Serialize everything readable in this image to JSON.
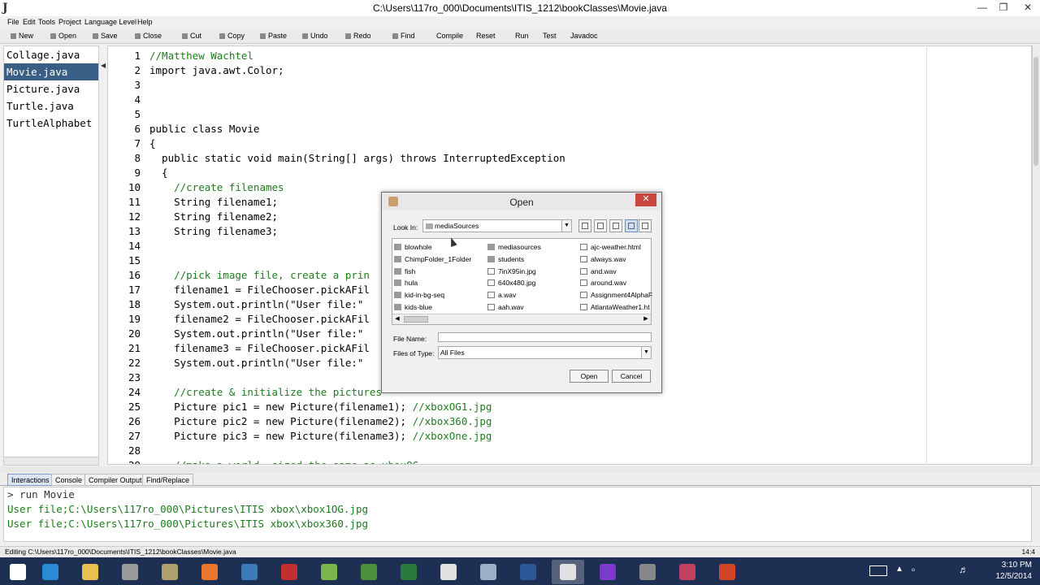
{
  "window": {
    "title": "C:\\Users\\117ro_000\\Documents\\ITIS_1212\\bookClasses\\Movie.java",
    "app_icon": "J"
  },
  "menu": [
    "File",
    "Edit",
    "Tools",
    "Project",
    "Language Level",
    "Help"
  ],
  "toolbar": [
    "New",
    "Open",
    "Save",
    "Close",
    "Cut",
    "Copy",
    "Paste",
    "Undo",
    "Redo",
    "Find",
    "Compile",
    "Reset",
    "Run",
    "Test",
    "Javadoc"
  ],
  "files": [
    "Collage.java",
    "Movie.java",
    "Picture.java",
    "Turtle.java",
    "TurtleAlphabet"
  ],
  "active_file": "Movie.java",
  "code": [
    {
      "n": "1",
      "text": "//Matthew Wachtel",
      "comment": true
    },
    {
      "n": "2",
      "text": "import java.awt.Color;",
      "comment": false
    },
    {
      "n": "3",
      "text": "",
      "comment": false
    },
    {
      "n": "4",
      "text": "",
      "comment": false
    },
    {
      "n": "5",
      "text": "",
      "comment": false
    },
    {
      "n": "6",
      "text": "public class Movie",
      "comment": false
    },
    {
      "n": "7",
      "text": "{",
      "comment": false
    },
    {
      "n": "8",
      "text": "  public static void main(String[] args) throws InterruptedException",
      "comment": false
    },
    {
      "n": "9",
      "text": "  {",
      "comment": false
    },
    {
      "n": "10",
      "text": "    //create filenames",
      "comment": true
    },
    {
      "n": "11",
      "text": "    String filename1;",
      "comment": false
    },
    {
      "n": "12",
      "text": "    String filename2;",
      "comment": false
    },
    {
      "n": "13",
      "text": "    String filename3;",
      "comment": false
    },
    {
      "n": "14",
      "text": "",
      "comment": false
    },
    {
      "n": "15",
      "text": "",
      "comment": false
    },
    {
      "n": "16",
      "text": "    //pick image file, create a prin",
      "comment": true
    },
    {
      "n": "17",
      "text": "    filename1 = FileChooser.pickAFil",
      "comment": false
    },
    {
      "n": "18",
      "text": "    System.out.println(\"User file:\"",
      "comment": false
    },
    {
      "n": "19",
      "text": "    filename2 = FileChooser.pickAFil",
      "comment": false
    },
    {
      "n": "20",
      "text": "    System.out.println(\"User file:\"",
      "comment": false
    },
    {
      "n": "21",
      "text": "    filename3 = FileChooser.pickAFil",
      "comment": false
    },
    {
      "n": "22",
      "text": "    System.out.println(\"User file:\"",
      "comment": false
    },
    {
      "n": "23",
      "text": "",
      "comment": false
    },
    {
      "n": "24",
      "text": "    //create & initialize the pictures",
      "comment": true
    },
    {
      "n": "25",
      "text": "    Picture pic1 = new Picture(filename1); ",
      "tail": "//xboxOG1.jpg",
      "comment": false
    },
    {
      "n": "26",
      "text": "    Picture pic2 = new Picture(filename2); ",
      "tail": "//xbox360.jpg",
      "comment": false
    },
    {
      "n": "27",
      "text": "    Picture pic3 = new Picture(filename3); ",
      "tail": "//xboxOne.jpg",
      "comment": false
    },
    {
      "n": "28",
      "text": "",
      "comment": false
    },
    {
      "n": "29",
      "text": "    //make a world, sized the same as xboxOG",
      "comment": true
    }
  ],
  "bottom_tabs": [
    "Interactions",
    "Console",
    "Compiler Output",
    "Find/Replace"
  ],
  "active_tab": "Interactions",
  "console": [
    {
      "text": "> run Movie",
      "kind": "cmd"
    },
    {
      "text": "User file;C:\\Users\\117ro_000\\Pictures\\ITIS xbox\\xbox1OG.jpg",
      "kind": "out"
    },
    {
      "text": "User file;C:\\Users\\117ro_000\\Pictures\\ITIS xbox\\xbox360.jpg",
      "kind": "out"
    }
  ],
  "status": {
    "text": "Editing C:\\Users\\117ro_000\\Documents\\ITIS_1212\\bookClasses\\Movie.java",
    "position": "14:4"
  },
  "dialog": {
    "title": "Open",
    "close": "✕",
    "look_in_label": "Look In:",
    "look_in_value": "mediaSources",
    "columns": [
      [
        {
          "name": "blowhole",
          "type": "folder"
        },
        {
          "name": "ChimpFolder_1Folder",
          "type": "folder"
        },
        {
          "name": "fish",
          "type": "folder"
        },
        {
          "name": "hula",
          "type": "folder"
        },
        {
          "name": "kid-in-bg-seq",
          "type": "folder"
        },
        {
          "name": "kids-blue",
          "type": "folder"
        }
      ],
      [
        {
          "name": "mediasources",
          "type": "folder"
        },
        {
          "name": "students",
          "type": "folder"
        },
        {
          "name": "7inX95in.jpg",
          "type": "file"
        },
        {
          "name": "640x480.jpg",
          "type": "file"
        },
        {
          "name": "a.wav",
          "type": "file"
        },
        {
          "name": "aah.wav",
          "type": "file"
        }
      ],
      [
        {
          "name": "ajc-weather.html",
          "type": "file"
        },
        {
          "name": "always.wav",
          "type": "file"
        },
        {
          "name": "and.wav",
          "type": "file"
        },
        {
          "name": "around.wav",
          "type": "file"
        },
        {
          "name": "Assignment4AlphaF",
          "type": "file"
        },
        {
          "name": "AtlantaWeather1.ht",
          "type": "file"
        }
      ]
    ],
    "file_name_label": "File Name:",
    "file_name_value": "",
    "files_of_type_label": "Files of Type:",
    "files_of_type_value": "All Files",
    "open_button": "Open",
    "cancel_button": "Cancel"
  },
  "taskbar": {
    "time": "3:10 PM",
    "date": "12/5/2014",
    "apps": [
      {
        "name": "start",
        "color": "#ffffff"
      },
      {
        "name": "internet-explorer",
        "color": "#2a8ad4"
      },
      {
        "name": "file-explorer",
        "color": "#e8c050"
      },
      {
        "name": "tool-a",
        "color": "#9a9a9a"
      },
      {
        "name": "tool-b",
        "color": "#b0a070"
      },
      {
        "name": "firefox",
        "color": "#e8762b"
      },
      {
        "name": "media",
        "color": "#3d7ab8"
      },
      {
        "name": "recorder",
        "color": "#c03030"
      },
      {
        "name": "itunes",
        "color": "#7ab648"
      },
      {
        "name": "chrome",
        "color": "#4a8f3c"
      },
      {
        "name": "excel",
        "color": "#2b7a3b"
      },
      {
        "name": "jes",
        "color": "#e0e0e0"
      },
      {
        "name": "snipping",
        "color": "#9ab0c8"
      },
      {
        "name": "word",
        "color": "#2b5797"
      },
      {
        "name": "drjava",
        "color": "#e0e0e0"
      },
      {
        "name": "search",
        "color": "#7a3cc8"
      },
      {
        "name": "misc",
        "color": "#888888"
      },
      {
        "name": "camera",
        "color": "#c04060"
      },
      {
        "name": "powerpoint",
        "color": "#d04525"
      }
    ]
  }
}
